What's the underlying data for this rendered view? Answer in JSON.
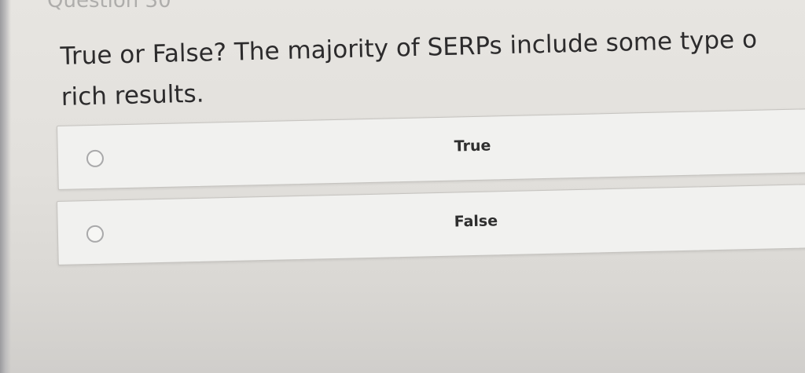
{
  "header": {
    "partial_title": "Question 30"
  },
  "question": {
    "text": "True or False? The majority of SERPs include some type o\nrich results."
  },
  "options": [
    {
      "label": "True",
      "selected": false
    },
    {
      "label": "False",
      "selected": false
    }
  ],
  "colors": {
    "background": "#e2e0dc",
    "option_background": "#f1f1ef",
    "text": "#2c2b2c",
    "radio_border": "#a9a9aa"
  }
}
